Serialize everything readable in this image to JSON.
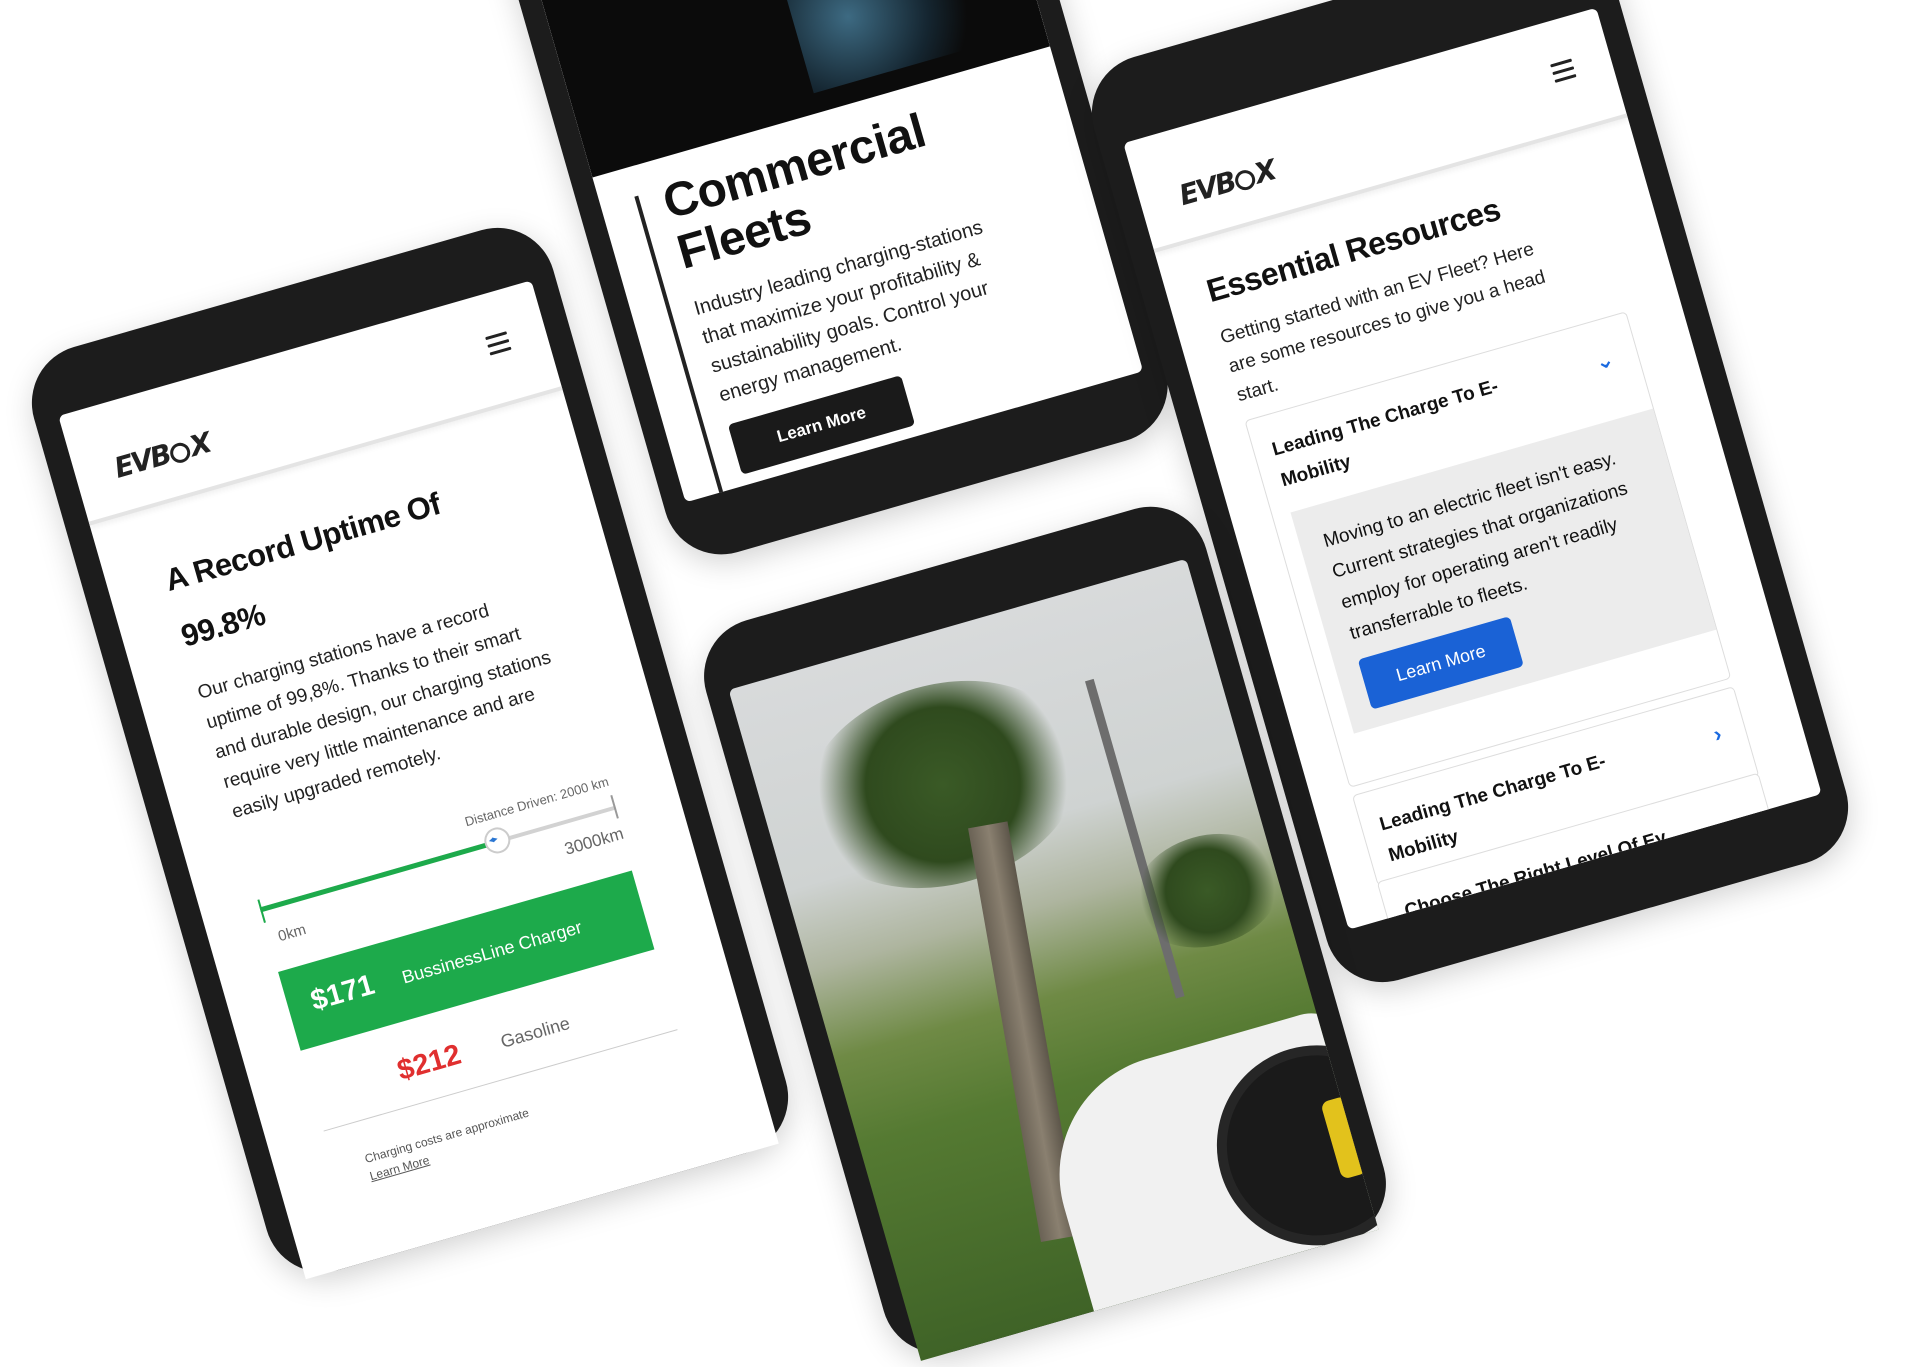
{
  "brand": {
    "logo_text_a": "EVB",
    "logo_text_b": "X"
  },
  "uptime": {
    "heading": "A Record Uptime Of 99.8%",
    "body": "Our charging stations have a record uptime of 99,8%. Thanks to their smart and durable design, our charging stations require very little maintenance and are easily upgraded remotely.",
    "slider": {
      "caption": "Distance Driven: 2000 km",
      "min_label": "0km",
      "max_label": "3000km",
      "value_fraction": 0.667
    },
    "charger": {
      "price": "$171",
      "name": "BussinessLine Charger"
    },
    "gasoline": {
      "price": "$212",
      "name": "Gasoline"
    },
    "footnote": {
      "text": "Charging costs are approximate",
      "link": "Learn More"
    },
    "colors": {
      "green": "#1daa4b",
      "red": "#e02f2f"
    }
  },
  "fleets": {
    "heading": "Commercial Fleets",
    "body": "Industry leading charging-stations that maximize your profitability & sustainability goals. Control your energy management.",
    "cta": "Learn More"
  },
  "resources": {
    "heading": "Essential Resources",
    "intro": "Getting started with an EV Fleet? Here are some resources to give you a head start.",
    "items": [
      {
        "title": "Leading The Charge To E-Mobility",
        "expanded": true,
        "icon": "chevron-down-icon",
        "content": "Moving to an electric fleet isn't easy. Current strategies that organizations employ for operating aren't readily transferrable to fleets.",
        "cta": "Learn More"
      },
      {
        "title": "Leading The Charge To E-Mobility",
        "expanded": false,
        "icon": "chevron-right-icon"
      },
      {
        "title": "Choose The Right Level Of Ev Charging",
        "expanded": false,
        "icon": "chevron-right-icon"
      }
    ],
    "colors": {
      "accent": "#1a62d6"
    }
  }
}
